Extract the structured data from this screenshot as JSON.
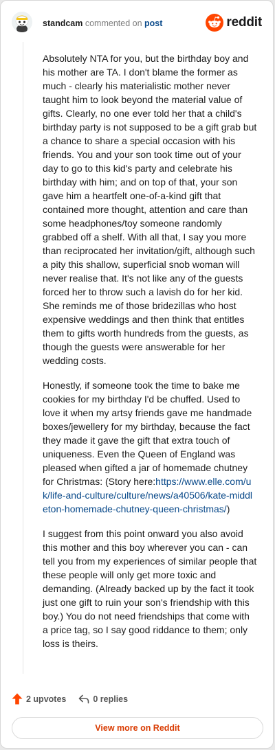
{
  "header": {
    "username": "standcam",
    "action_text": "commented on",
    "post_link": "post",
    "logo_text": "reddit"
  },
  "comment": {
    "para1": "Absolutely NTA for you, but the birthday boy and his mother are TA. I don't blame the former as much - clearly his materialistic mother never taught him to look beyond the material value of gifts. Clearly, no one ever told her that a child's birthday party is not supposed to be a gift grab but a chance to share a special occasion with his friends. You and your son took time out of your day to go to this kid's party and celebrate his birthday with him; and on top of that, your son gave him a heartfelt one-of-a-kind gift that contained more thought, attention and care than some headphones/toy someone randomly grabbed off a shelf. With all that, I say you more than reciprocated her invitation/gift, although such a pity this shallow, superficial snob woman will never realise that. It's not like any of the guests forced her to throw such a lavish do for her kid. She reminds me of those bridezillas who host expensive weddings and then think that entitles them to gifts worth hundreds from the guests, as though the guests were answerable for her wedding costs.",
    "para2_text": "Honestly, if someone took the time to bake me cookies for my birthday I'd be chuffed. Used to love it when my artsy friends gave me handmade boxes/jewellery for my birthday, because the fact they made it gave the gift that extra touch of uniqueness. Even the Queen of England was pleased when gifted a jar of homemade chutney for Christmas: (Story here:",
    "para2_link": "https://www.elle.com/uk/life-and-culture/culture/news/a40506/kate-middleton-homemade-chutney-queen-christmas/",
    "para2_tail": ")",
    "para3": "I suggest from this point onward you also avoid this mother and this boy wherever you can - can tell you from my experiences of similar people that these people will only get more toxic and demanding. (Already backed up by the fact it took just one gift to ruin your son's friendship with this boy.) You do not need friendships that come with a price tag, so I say good riddance to them; only loss is theirs."
  },
  "actions": {
    "upvotes": "2 upvotes",
    "replies": "0 replies"
  },
  "footer": {
    "view_more": "View more on Reddit"
  },
  "colors": {
    "accent": "#ff4500",
    "link": "#0a4a8a",
    "button_text": "#d93a00"
  }
}
